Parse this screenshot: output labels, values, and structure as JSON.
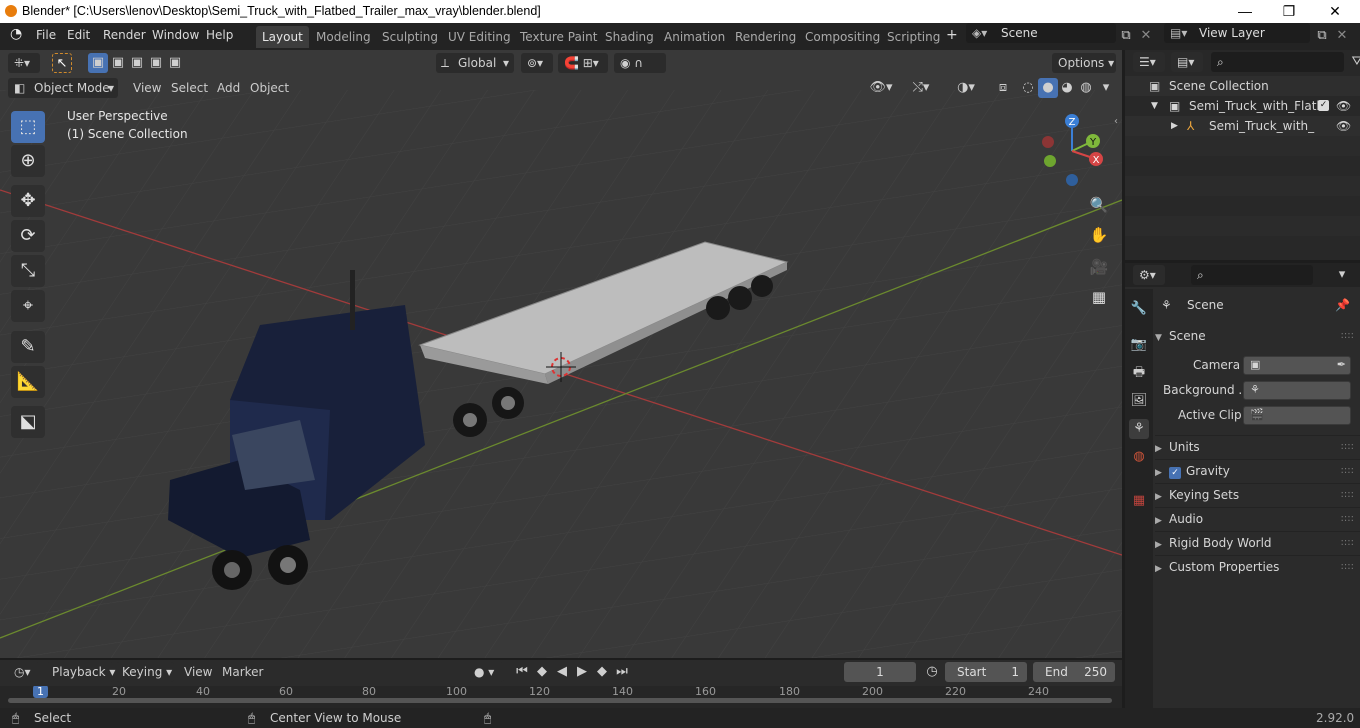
{
  "window": {
    "title": "Blender* [C:\\Users\\lenov\\Desktop\\Semi_Truck_with_Flatbed_Trailer_max_vray\\blender.blend]",
    "minimize": "—",
    "maximize": "❐",
    "close": "✕"
  },
  "menu": {
    "file": "File",
    "edit": "Edit",
    "render": "Render",
    "window": "Window",
    "help": "Help"
  },
  "workspaces": [
    "Layout",
    "Modeling",
    "Sculpting",
    "UV Editing",
    "Texture Paint",
    "Shading",
    "Animation",
    "Rendering",
    "Compositing",
    "Scripting"
  ],
  "scene_name": "Scene",
  "view_layer": "View Layer",
  "viewport": {
    "transform_orientation": "Global",
    "options": "Options",
    "mode": "Object Mode",
    "menus": [
      "View",
      "Select",
      "Add",
      "Object"
    ],
    "perspective": "User Perspective",
    "collection": "(1) Scene Collection",
    "gizmo": {
      "z": "Z",
      "y": "Y",
      "x": "X"
    }
  },
  "outliner": {
    "root": "Scene Collection",
    "collection": "Semi_Truck_with_Flatbe",
    "object": "Semi_Truck_with_Fla"
  },
  "properties": {
    "scene_title": "Scene",
    "panel": "Scene",
    "camera_label": "Camera",
    "background_label": "Background ...",
    "active_clip_label": "Active Clip",
    "sections": [
      "Units",
      "Gravity",
      "Keying Sets",
      "Audio",
      "Rigid Body World",
      "Custom Properties"
    ],
    "gravity_checked": true
  },
  "timeline": {
    "menus": [
      "Playback",
      "Keying",
      "View",
      "Marker"
    ],
    "current_frame": "1",
    "start_label": "Start",
    "start": "1",
    "end_label": "End",
    "end": "250",
    "ruler": [
      "1",
      "20",
      "40",
      "60",
      "80",
      "100",
      "120",
      "140",
      "160",
      "180",
      "200",
      "220",
      "240"
    ]
  },
  "status": {
    "select": "Select",
    "center": "Center View to Mouse",
    "version": "2.92.0"
  }
}
